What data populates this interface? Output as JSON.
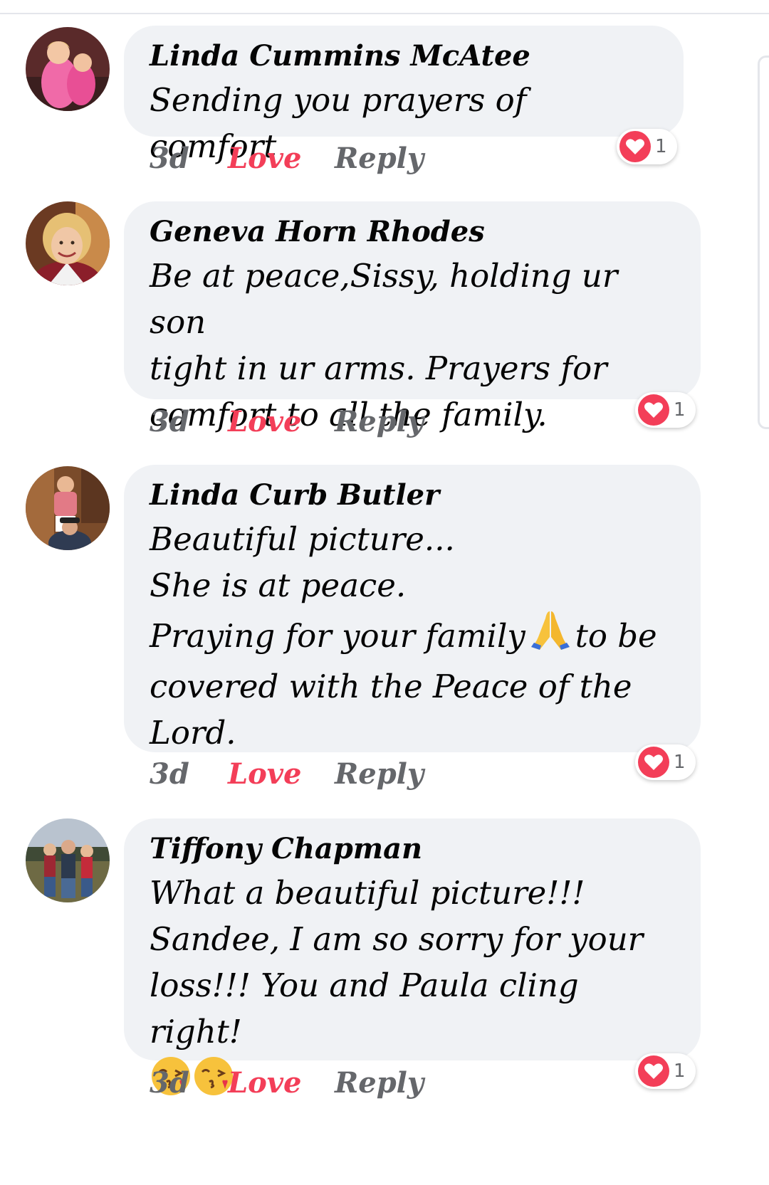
{
  "comments": [
    {
      "author": "Linda Cummins McAtee",
      "lines": [
        "Sending you prayers of comfort"
      ],
      "time": "3d",
      "love_label": "Love",
      "reply_label": "Reply",
      "reaction_icon": "heart-icon",
      "reaction_count": "1"
    },
    {
      "author": "Geneva Horn Rhodes",
      "lines": [
        "Be at peace,Sissy, holding ur son",
        "tight in ur arms. Prayers for",
        "comfort to all the family."
      ],
      "time": "3d",
      "love_label": "Love",
      "reply_label": "Reply",
      "reaction_icon": "heart-icon",
      "reaction_count": "1"
    },
    {
      "author": "Linda Curb Butler",
      "line1": "Beautiful picture...",
      "line2": "She is at peace.",
      "line3_before": "Praying for your family",
      "line3_emoji": "folded-hands-emoji",
      "line3_after": "to be",
      "line4": "covered with the Peace of the",
      "line5": "Lord.",
      "time": "3d",
      "love_label": "Love",
      "reply_label": "Reply",
      "reaction_icon": "heart-icon",
      "reaction_count": "1"
    },
    {
      "author": "Tiffony Chapman",
      "lines": [
        "What a beautiful picture!!!",
        "Sandee, I am so sorry for your",
        "loss!!! You and Paula cling right!"
      ],
      "emoji": [
        "face-blowing-kiss-emoji",
        "face-blowing-kiss-emoji"
      ],
      "time": "3d",
      "love_label": "Love",
      "reply_label": "Reply",
      "reaction_icon": "heart-icon",
      "reaction_count": "1"
    }
  ],
  "colors": {
    "love_active": "#f33e58",
    "meta_gray": "#65676b",
    "bubble_bg": "#f0f2f5"
  }
}
